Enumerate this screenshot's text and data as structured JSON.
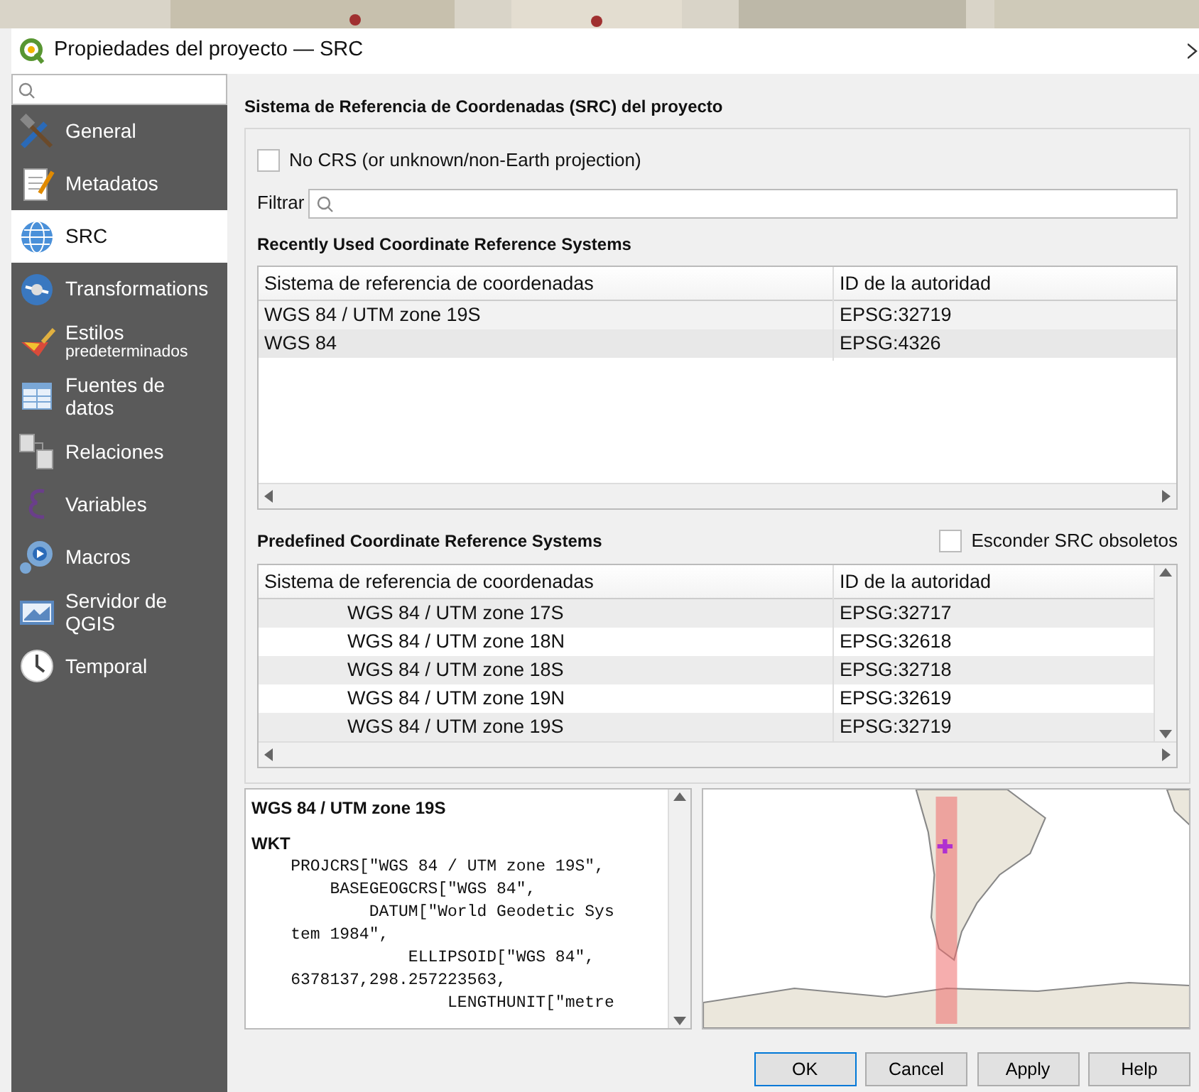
{
  "window": {
    "title": "Propiedades del proyecto — SRC"
  },
  "sidebar": {
    "items": [
      {
        "label": "General",
        "kind": "general",
        "selected": false
      },
      {
        "label": "Metadatos",
        "kind": "metadata",
        "selected": false
      },
      {
        "label": "SRC",
        "kind": "globe",
        "selected": true
      },
      {
        "label": "Transformations",
        "kind": "transform",
        "selected": false
      },
      {
        "label": "Estilos",
        "sublabel": "predeterminados",
        "kind": "styles",
        "selected": false
      },
      {
        "label": "Fuentes de datos",
        "kind": "sources",
        "selected": false
      },
      {
        "label": "Relaciones",
        "kind": "relations",
        "selected": false
      },
      {
        "label": "Variables",
        "kind": "variables",
        "selected": false
      },
      {
        "label": "Macros",
        "kind": "macros",
        "selected": false
      },
      {
        "label": "Servidor de QGIS",
        "kind": "server",
        "selected": false
      },
      {
        "label": "Temporal",
        "kind": "temporal",
        "selected": false
      }
    ]
  },
  "section_title": "Sistema de Referencia de Coordenadas (SRC) del proyecto",
  "no_crs": {
    "label": "No CRS (or unknown/non-Earth projection)",
    "checked": false
  },
  "filter": {
    "label": "Filtrar"
  },
  "recent": {
    "title": "Recently Used Coordinate Reference Systems",
    "columns": [
      "Sistema de referencia de coordenadas",
      "ID de la autoridad"
    ],
    "rows": [
      {
        "name": "WGS 84 / UTM zone 19S",
        "id": "EPSG:32719"
      },
      {
        "name": "WGS 84",
        "id": "EPSG:4326"
      }
    ]
  },
  "predefined": {
    "title": "Predefined Coordinate Reference Systems",
    "hide_deprecated": {
      "label": "Esconder SRC obsoletos",
      "checked": false
    },
    "columns": [
      "Sistema de referencia de coordenadas",
      "ID de la autoridad"
    ],
    "rows": [
      {
        "name": "WGS 84 / UTM zone 17S",
        "id": "EPSG:32717"
      },
      {
        "name": "WGS 84 / UTM zone 18N",
        "id": "EPSG:32618"
      },
      {
        "name": "WGS 84 / UTM zone 18S",
        "id": "EPSG:32718"
      },
      {
        "name": "WGS 84 / UTM zone 19N",
        "id": "EPSG:32619"
      },
      {
        "name": "WGS 84 / UTM zone 19S",
        "id": "EPSG:32719"
      }
    ]
  },
  "details": {
    "name": "WGS 84 / UTM zone 19S",
    "wkt_label": "WKT",
    "wkt": "    PROJCRS[\"WGS 84 / UTM zone 19S\",\n        BASEGEOGCRS[\"WGS 84\",\n            DATUM[\"World Geodetic Sys\n    tem 1984\",\n                ELLIPSOID[\"WGS 84\",\n    6378137,298.257223563,\n                    LENGTHUNIT[\"metre"
  },
  "buttons": [
    {
      "label": "OK",
      "default": true
    },
    {
      "label": "Cancel",
      "default": false
    },
    {
      "label": "Apply",
      "default": false
    },
    {
      "label": "Help",
      "default": false
    }
  ]
}
